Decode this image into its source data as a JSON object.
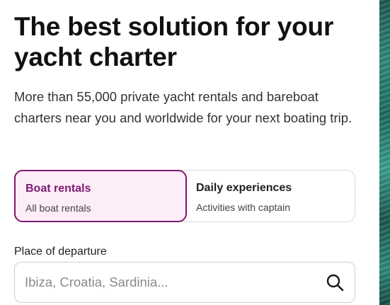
{
  "hero": {
    "title": "The best solution for your yacht charter",
    "subtitle": "More than 55,000 private yacht rentals and bareboat charters near you and worldwide for your next boating trip."
  },
  "tabs": [
    {
      "title": "Boat rentals",
      "subtitle": "All boat rentals",
      "active": true
    },
    {
      "title": "Daily experiences",
      "subtitle": "Activities with captain",
      "active": false
    }
  ],
  "search": {
    "label": "Place of departure",
    "placeholder": "Ibiza, Croatia, Sardinia...",
    "value": "",
    "icon": "search-icon"
  },
  "colors": {
    "accent": "#7d1a70",
    "active_tab_bg": "#fcedf9",
    "border": "#d9d9d9"
  }
}
